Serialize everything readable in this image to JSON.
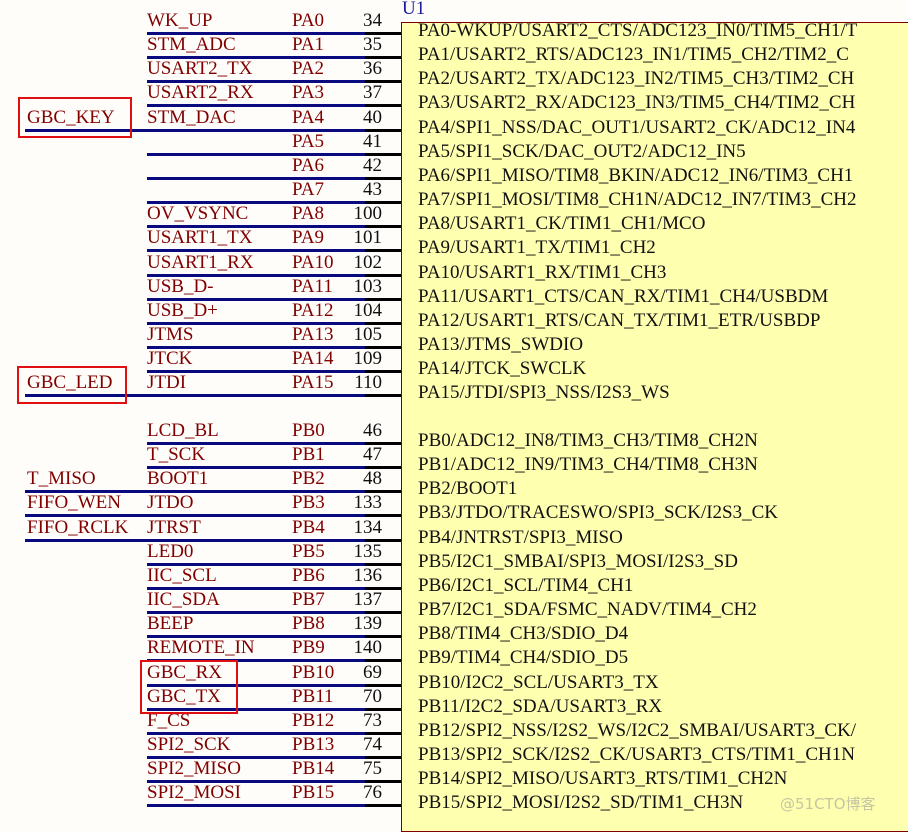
{
  "designator": "U1",
  "pa_pins": [
    {
      "net": "WK_UP",
      "pin": "PA0",
      "num": "34",
      "fn": "PA0-WKUP/USART2_CTS/ADC123_IN0/TIM5_CH1/T"
    },
    {
      "net": "STM_ADC",
      "pin": "PA1",
      "num": "35",
      "fn": "PA1/USART2_RTS/ADC123_IN1/TIM5_CH2/TIM2_C"
    },
    {
      "net": "USART2_TX",
      "pin": "PA2",
      "num": "36",
      "fn": "PA2/USART2_TX/ADC123_IN2/TIM5_CH3/TIM2_CH"
    },
    {
      "net": "USART2_RX",
      "pin": "PA3",
      "num": "37",
      "fn": "PA3/USART2_RX/ADC123_IN3/TIM5_CH4/TIM2_CH"
    },
    {
      "net": "STM_DAC",
      "pin": "PA4",
      "num": "40",
      "fn": "PA4/SPI1_NSS/DAC_OUT1/USART2_CK/ADC12_IN4",
      "ext": "GBC_KEY",
      "highlight": true
    },
    {
      "net": "",
      "pin": "PA5",
      "num": "41",
      "fn": "PA5/SPI1_SCK/DAC_OUT2/ADC12_IN5"
    },
    {
      "net": "",
      "pin": "PA6",
      "num": "42",
      "fn": "PA6/SPI1_MISO/TIM8_BKIN/ADC12_IN6/TIM3_CH1"
    },
    {
      "net": "",
      "pin": "PA7",
      "num": "43",
      "fn": "PA7/SPI1_MOSI/TIM8_CH1N/ADC12_IN7/TIM3_CH2"
    },
    {
      "net": "OV_VSYNC",
      "pin": "PA8",
      "num": "100",
      "fn": "PA8/USART1_CK/TIM1_CH1/MCO"
    },
    {
      "net": "USART1_TX",
      "pin": "PA9",
      "num": "101",
      "fn": "PA9/USART1_TX/TIM1_CH2"
    },
    {
      "net": "USART1_RX",
      "pin": "PA10",
      "num": "102",
      "fn": "PA10/USART1_RX/TIM1_CH3"
    },
    {
      "net": "USB_D-",
      "pin": "PA11",
      "num": "103",
      "fn": "PA11/USART1_CTS/CAN_RX/TIM1_CH4/USBDM"
    },
    {
      "net": "USB_D+",
      "pin": "PA12",
      "num": "104",
      "fn": "PA12/USART1_RTS/CAN_TX/TIM1_ETR/USBDP"
    },
    {
      "net": "JTMS",
      "pin": "PA13",
      "num": "105",
      "fn": "PA13/JTMS_SWDIO"
    },
    {
      "net": "JTCK",
      "pin": "PA14",
      "num": "109",
      "fn": "PA14/JTCK_SWCLK"
    },
    {
      "net": "JTDI",
      "pin": "PA15",
      "num": "110",
      "fn": "PA15/JTDI/SPI3_NSS/I2S3_WS",
      "ext": "GBC_LED",
      "highlight": true
    }
  ],
  "pb_pins": [
    {
      "net": "LCD_BL",
      "pin": "PB0",
      "num": "46",
      "fn": "PB0/ADC12_IN8/TIM3_CH3/TIM8_CH2N"
    },
    {
      "net": "T_SCK",
      "pin": "PB1",
      "num": "47",
      "fn": "PB1/ADC12_IN9/TIM3_CH4/TIM8_CH3N"
    },
    {
      "net": "BOOT1",
      "pin": "PB2",
      "num": "48",
      "fn": "PB2/BOOT1",
      "ext": "T_MISO"
    },
    {
      "net": "JTDO",
      "pin": "PB3",
      "num": "133",
      "fn": "PB3/JTDO/TRACESWO/SPI3_SCK/I2S3_CK",
      "ext": "FIFO_WEN"
    },
    {
      "net": "JTRST",
      "pin": "PB4",
      "num": "134",
      "fn": "PB4/JNTRST/SPI3_MISO",
      "ext": "FIFO_RCLK"
    },
    {
      "net": "LED0",
      "pin": "PB5",
      "num": "135",
      "fn": "PB5/I2C1_SMBAI/SPI3_MOSI/I2S3_SD"
    },
    {
      "net": "IIC_SCL",
      "pin": "PB6",
      "num": "136",
      "fn": "PB6/I2C1_SCL/TIM4_CH1"
    },
    {
      "net": "IIC_SDA",
      "pin": "PB7",
      "num": "137",
      "fn": "PB7/I2C1_SDA/FSMC_NADV/TIM4_CH2"
    },
    {
      "net": "BEEP",
      "pin": "PB8",
      "num": "139",
      "fn": "PB8/TIM4_CH3/SDIO_D4"
    },
    {
      "net": "REMOTE_IN",
      "pin": "PB9",
      "num": "140",
      "fn": "PB9/TIM4_CH4/SDIO_D5"
    },
    {
      "net": "GBC_RX",
      "pin": "PB10",
      "num": "69",
      "fn": "PB10/I2C2_SCL/USART3_TX",
      "highlight": true
    },
    {
      "net": "GBC_TX",
      "pin": "PB11",
      "num": "70",
      "fn": "PB11/I2C2_SDA/USART3_RX",
      "highlight": true
    },
    {
      "net": "F_CS",
      "pin": "PB12",
      "num": "73",
      "fn": "PB12/SPI2_NSS/I2S2_WS/I2C2_SMBAI/USART3_CK/"
    },
    {
      "net": "SPI2_SCK",
      "pin": "PB13",
      "num": "74",
      "fn": "PB13/SPI2_SCK/I2S2_CK/USART3_CTS/TIM1_CH1N"
    },
    {
      "net": "SPI2_MISO",
      "pin": "PB14",
      "num": "75",
      "fn": "PB14/SPI2_MISO/USART3_RTS/TIM1_CH2N"
    },
    {
      "net": "SPI2_MOSI",
      "pin": "PB15",
      "num": "76",
      "fn": "PB15/SPI2_MOSI/I2S2_SD/TIM1_CH3N"
    }
  ],
  "colors": {
    "wire": "#0a0a80",
    "net_label": "#800000",
    "chip_fill": "#ffffb0",
    "highlight_box": "#e01010"
  },
  "watermark": "@51CTO博客"
}
